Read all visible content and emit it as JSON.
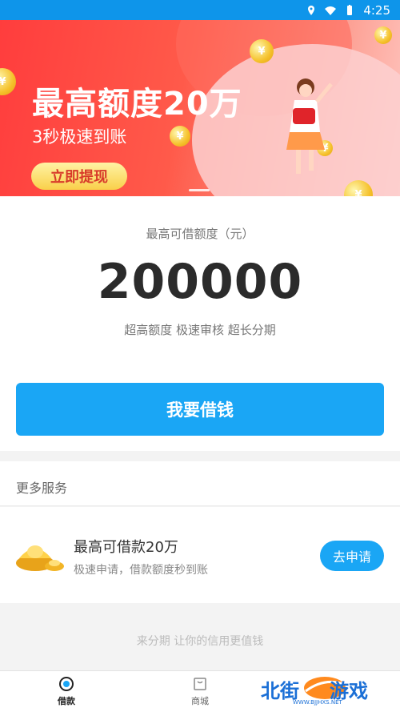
{
  "status_bar": {
    "time": "4:25"
  },
  "banner": {
    "headline": "最高额度20万",
    "subline": "3秒极速到账",
    "button": "立即提现",
    "coin_symbol": "¥"
  },
  "loan": {
    "label": "最高可借额度（元）",
    "amount": "200000",
    "tagline": "超高额度 极速审核 超长分期",
    "borrow_button": "我要借钱"
  },
  "more_services": {
    "title": "更多服务",
    "item": {
      "title": "最高可借款20万",
      "desc": "极速申请，借款额度秒到账",
      "button": "去申请"
    }
  },
  "footer": {
    "note": "来分期 让你的信用更值钱"
  },
  "tabs": [
    {
      "label": "借款",
      "icon": "loan-icon",
      "active": true
    },
    {
      "label": "商城",
      "icon": "mall-icon",
      "active": false
    }
  ],
  "watermark": {
    "left": "北街",
    "right": "游戏",
    "url": "WWW.BJJHXS.NET"
  },
  "colors": {
    "primary": "#1aa6f5",
    "status": "#0e95ea",
    "banner": "#ff3d3d"
  }
}
